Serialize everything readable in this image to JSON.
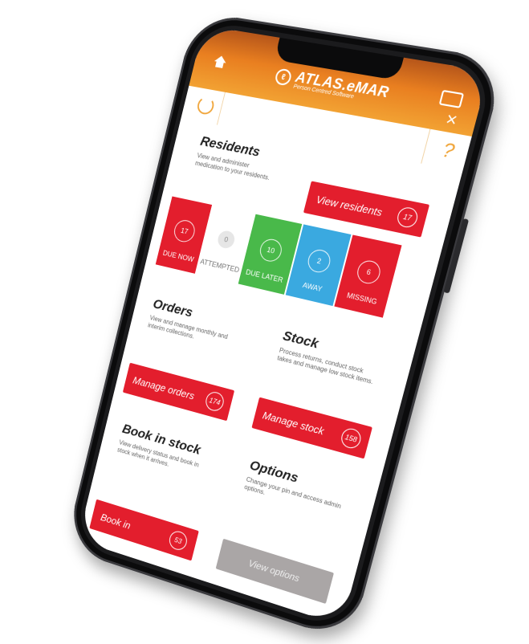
{
  "header": {
    "logo_text": "ATLAS.eMAR",
    "logo_sub": "Person Centred Software",
    "close_label": "×"
  },
  "search": {
    "value": "",
    "help": "?"
  },
  "residents": {
    "title": "Residents",
    "desc": "View and administer medication to your residents.",
    "button_label": "View residents",
    "button_count": "17",
    "tiles": [
      {
        "label": "DUE NOW",
        "count": "17",
        "color": "#e31e2d"
      },
      {
        "label": "ATTEMPTED",
        "count": "0",
        "color": "#ffffff"
      },
      {
        "label": "DUE LATER",
        "count": "10",
        "color": "#49b94a"
      },
      {
        "label": "AWAY",
        "count": "2",
        "color": "#3aa9e0"
      },
      {
        "label": "MISSING",
        "count": "6",
        "color": "#e31e2d"
      }
    ]
  },
  "orders": {
    "title": "Orders",
    "desc": "View and manage monthly and interim collections.",
    "button_label": "Manage orders",
    "button_count": "174"
  },
  "stock": {
    "title": "Stock",
    "desc": "Process returns, conduct stock takes and manage low stock items.",
    "button_label": "Manage stock",
    "button_count": "158"
  },
  "bookin": {
    "title": "Book in stock",
    "desc": "View delivery status and book in stock when it arrives.",
    "button_label": "Book in",
    "button_count": "53"
  },
  "options": {
    "title": "Options",
    "desc": "Change your pin and access admin options.",
    "button_label": "View options"
  }
}
